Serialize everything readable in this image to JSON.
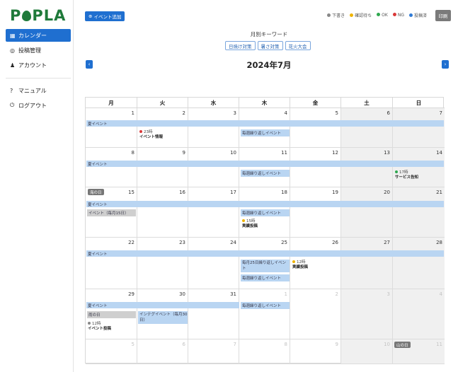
{
  "brand": {
    "logo_text_left": "P",
    "logo_text_right": "PLA",
    "logo_color": "#1f7a3a"
  },
  "sidebar": {
    "items": [
      {
        "label": "カレンダー",
        "icon": "calendar-icon",
        "glyph": "▦"
      },
      {
        "label": "投稿管理",
        "icon": "post-icon",
        "glyph": "◎"
      },
      {
        "label": "アカウント",
        "icon": "user-icon",
        "glyph": "♟"
      },
      {
        "label": "マニュアル",
        "icon": "question-icon",
        "glyph": "?"
      },
      {
        "label": "ログアウト",
        "icon": "power-icon",
        "glyph": "⏻"
      }
    ]
  },
  "toolbar": {
    "add_event_label": "イベント追加",
    "print_label": "印刷"
  },
  "legend": [
    {
      "label": "下書き",
      "color": "#888888"
    },
    {
      "label": "確認待ち",
      "color": "#f0b400"
    },
    {
      "label": "OK",
      "color": "#2fa84f"
    },
    {
      "label": "NG",
      "color": "#d93838"
    },
    {
      "label": "投稿済",
      "color": "#2f7bd6"
    }
  ],
  "keywords": {
    "title": "月別キーワード",
    "tags": [
      "日焼け対策",
      "暑さ対策",
      "花火大会"
    ]
  },
  "calendar": {
    "title": "2024年7月",
    "weekdays": [
      "月",
      "火",
      "水",
      "木",
      "金",
      "土",
      "日"
    ],
    "weeks": [
      [
        "1",
        "2",
        "3",
        "4",
        "5",
        "6",
        "7"
      ],
      [
        "8",
        "9",
        "10",
        "11",
        "12",
        "13",
        "14"
      ],
      [
        "15",
        "16",
        "17",
        "18",
        "19",
        "20",
        "21"
      ],
      [
        "22",
        "23",
        "24",
        "25",
        "26",
        "27",
        "28"
      ],
      [
        "29",
        "30",
        "31",
        "1",
        "2",
        "3",
        "4"
      ],
      [
        "5",
        "6",
        "7",
        "8",
        "9",
        "10",
        "11"
      ]
    ],
    "band_label": "夏イベント",
    "repeat_label": "毎週繰り返しイベント",
    "monthly25_label": "毎月25日繰り返しイベント",
    "monthly_event_label": "イベント（毎月15日）",
    "interval_event_label": "インテグイベント（毎月30日）",
    "holiday_umi": "海の日",
    "holiday_yama": "山の日",
    "rain_day": "雨の日",
    "posts": {
      "w1_time": "23時",
      "w1_name": "イベント情報",
      "w2_time": "17時",
      "w2_name": "サービス告知",
      "w3_time": "15時",
      "w3_name": "実績投稿",
      "w4_time": "12時",
      "w4_name": "実績投稿",
      "w5_time": "12時",
      "w5_name": "イベント投稿"
    },
    "post_colors": {
      "red": "#d93838",
      "green": "#2fa84f",
      "yellow": "#f0b400",
      "gray": "#888888"
    }
  }
}
